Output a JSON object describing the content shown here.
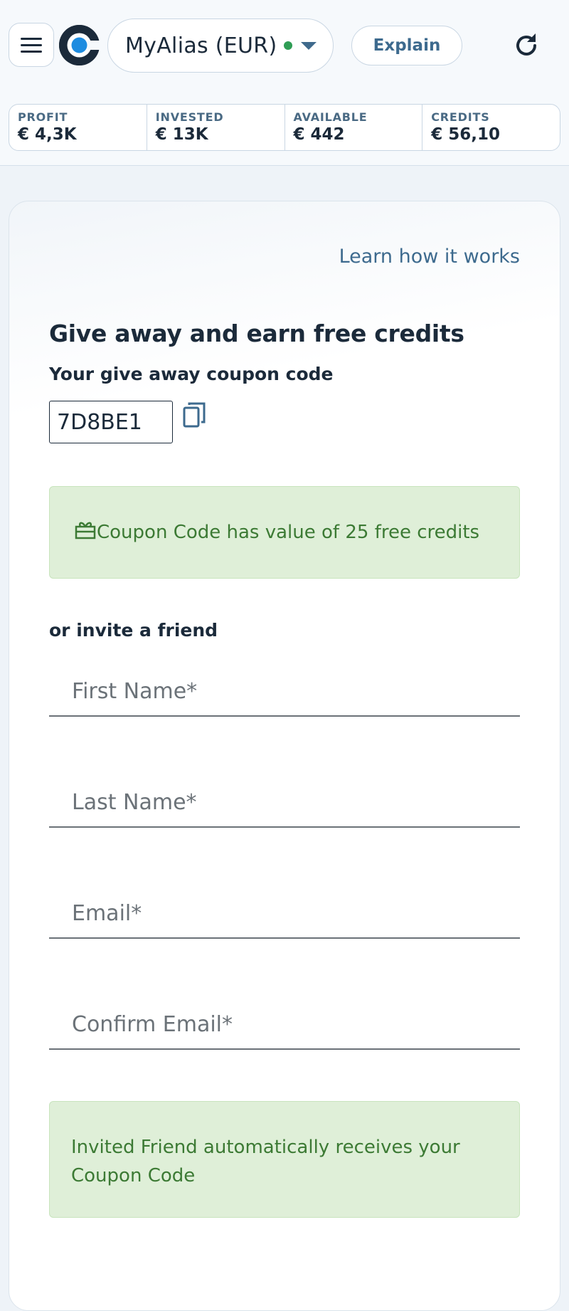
{
  "header": {
    "account_name": "MyAlias (EUR)",
    "explain_label": "Explain",
    "status_color": "#2f9d55"
  },
  "stats": [
    {
      "label": "PROFIT",
      "value": "€ 4,3K"
    },
    {
      "label": "INVESTED",
      "value": "€ 13K"
    },
    {
      "label": "AVAILABLE",
      "value": "€ 442"
    },
    {
      "label": "CREDITS",
      "value": "€ 56,10"
    }
  ],
  "card": {
    "learn_link": "Learn how it works",
    "heading": "Give away and earn free credits",
    "coupon_label": "Your give away coupon code",
    "coupon_code": "7D8BE1",
    "coupon_alert": "Coupon Code has value of 25 free credits",
    "invite_label": "or invite a friend",
    "fields": {
      "first_name": "First Name*",
      "last_name": "Last Name*",
      "email": "Email*",
      "confirm_email": "Confirm Email*"
    },
    "invite_alert": "Invited Friend automatically receives your Coupon Code"
  },
  "icons": {
    "menu": "hamburger-icon",
    "logo": "brand-logo",
    "caret": "chevron-down-icon",
    "refresh": "refresh-icon",
    "copy": "copy-icon",
    "gift": "gift-icon"
  },
  "colors": {
    "accent": "#3d6a8e",
    "success_bg": "#dfefd8",
    "success_text": "#3c7a34",
    "logo_blue": "#1e8ce0"
  }
}
